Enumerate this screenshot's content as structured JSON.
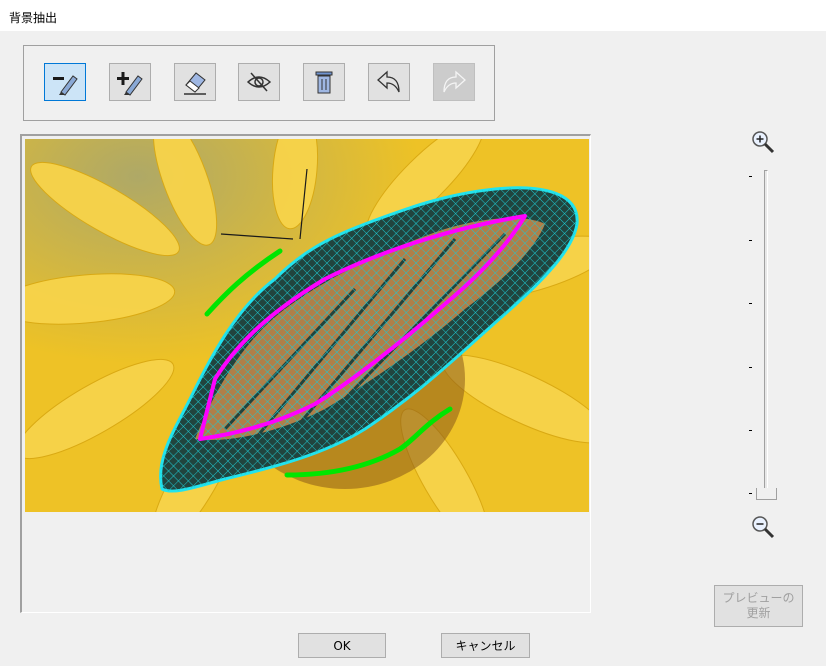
{
  "window": {
    "title": "背景抽出"
  },
  "toolbar": {
    "tools": [
      {
        "name": "erase-mark",
        "icon": "minus-pen-icon",
        "state": "selected"
      },
      {
        "name": "add-mark",
        "icon": "plus-pen-icon",
        "state": "normal"
      },
      {
        "name": "eraser",
        "icon": "eraser-icon",
        "state": "normal"
      },
      {
        "name": "hide",
        "icon": "eye-slash-icon",
        "state": "normal"
      },
      {
        "name": "clear",
        "icon": "trash-icon",
        "state": "normal"
      },
      {
        "name": "undo",
        "icon": "undo-icon",
        "state": "normal"
      },
      {
        "name": "redo",
        "icon": "redo-icon",
        "state": "disabled"
      }
    ]
  },
  "zoom": {
    "in_icon": "zoom-in-icon",
    "out_icon": "zoom-out-icon",
    "level": 0,
    "tick_count": 6
  },
  "buttons": {
    "preview_line1": "プレビューの",
    "preview_line2": "更新",
    "ok": "OK",
    "cancel": "キャンセル"
  },
  "colors": {
    "remove_mark": "#ff00ff",
    "keep_mark": "#00e600",
    "selection_outline": "#00ffff"
  }
}
